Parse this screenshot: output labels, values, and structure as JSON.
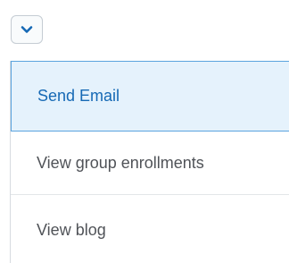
{
  "toggle": {
    "icon": "chevron-down-icon",
    "icon_color": "#1669b5"
  },
  "menu": {
    "items": [
      {
        "label": "Send Email",
        "active": true
      },
      {
        "label": "View group enrollments",
        "active": false
      },
      {
        "label": "View blog",
        "active": false
      }
    ]
  },
  "colors": {
    "accent": "#1669b5",
    "active_background": "#e5f2fc",
    "active_border": "#5ba4de",
    "text": "#505358"
  }
}
